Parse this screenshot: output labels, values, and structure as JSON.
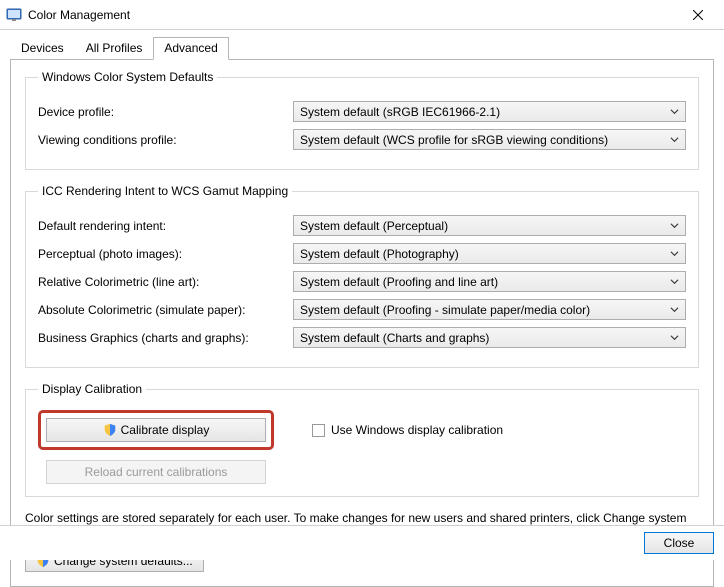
{
  "window": {
    "title": "Color Management",
    "close_icon": "close-icon"
  },
  "tabs": {
    "devices": "Devices",
    "all_profiles": "All Profiles",
    "advanced": "Advanced"
  },
  "groups": {
    "wcs_defaults": {
      "legend": "Windows Color System Defaults",
      "device_profile_label": "Device profile:",
      "device_profile_value": "System default (sRGB IEC61966-2.1)",
      "viewing_conditions_label": "Viewing conditions profile:",
      "viewing_conditions_value": "System default (WCS profile for sRGB viewing conditions)"
    },
    "rendering_intent": {
      "legend": "ICC Rendering Intent to WCS Gamut Mapping",
      "default_intent_label": "Default rendering intent:",
      "default_intent_value": "System default (Perceptual)",
      "perceptual_label": "Perceptual (photo images):",
      "perceptual_value": "System default (Photography)",
      "relative_label": "Relative Colorimetric (line art):",
      "relative_value": "System default (Proofing and line art)",
      "absolute_label": "Absolute Colorimetric (simulate paper):",
      "absolute_value": "System default (Proofing - simulate paper/media color)",
      "business_label": "Business Graphics (charts and graphs):",
      "business_value": "System default (Charts and graphs)"
    },
    "display_calibration": {
      "legend": "Display Calibration",
      "calibrate_button": "Calibrate display",
      "use_windows_checkbox": "Use Windows display calibration",
      "reload_button": "Reload current calibrations"
    }
  },
  "footer": {
    "info_text": "Color settings are stored separately for each user. To make changes for new users and shared printers, click Change system defaults.",
    "change_defaults_button": "Change system defaults..."
  },
  "bottom": {
    "close_button": "Close"
  }
}
